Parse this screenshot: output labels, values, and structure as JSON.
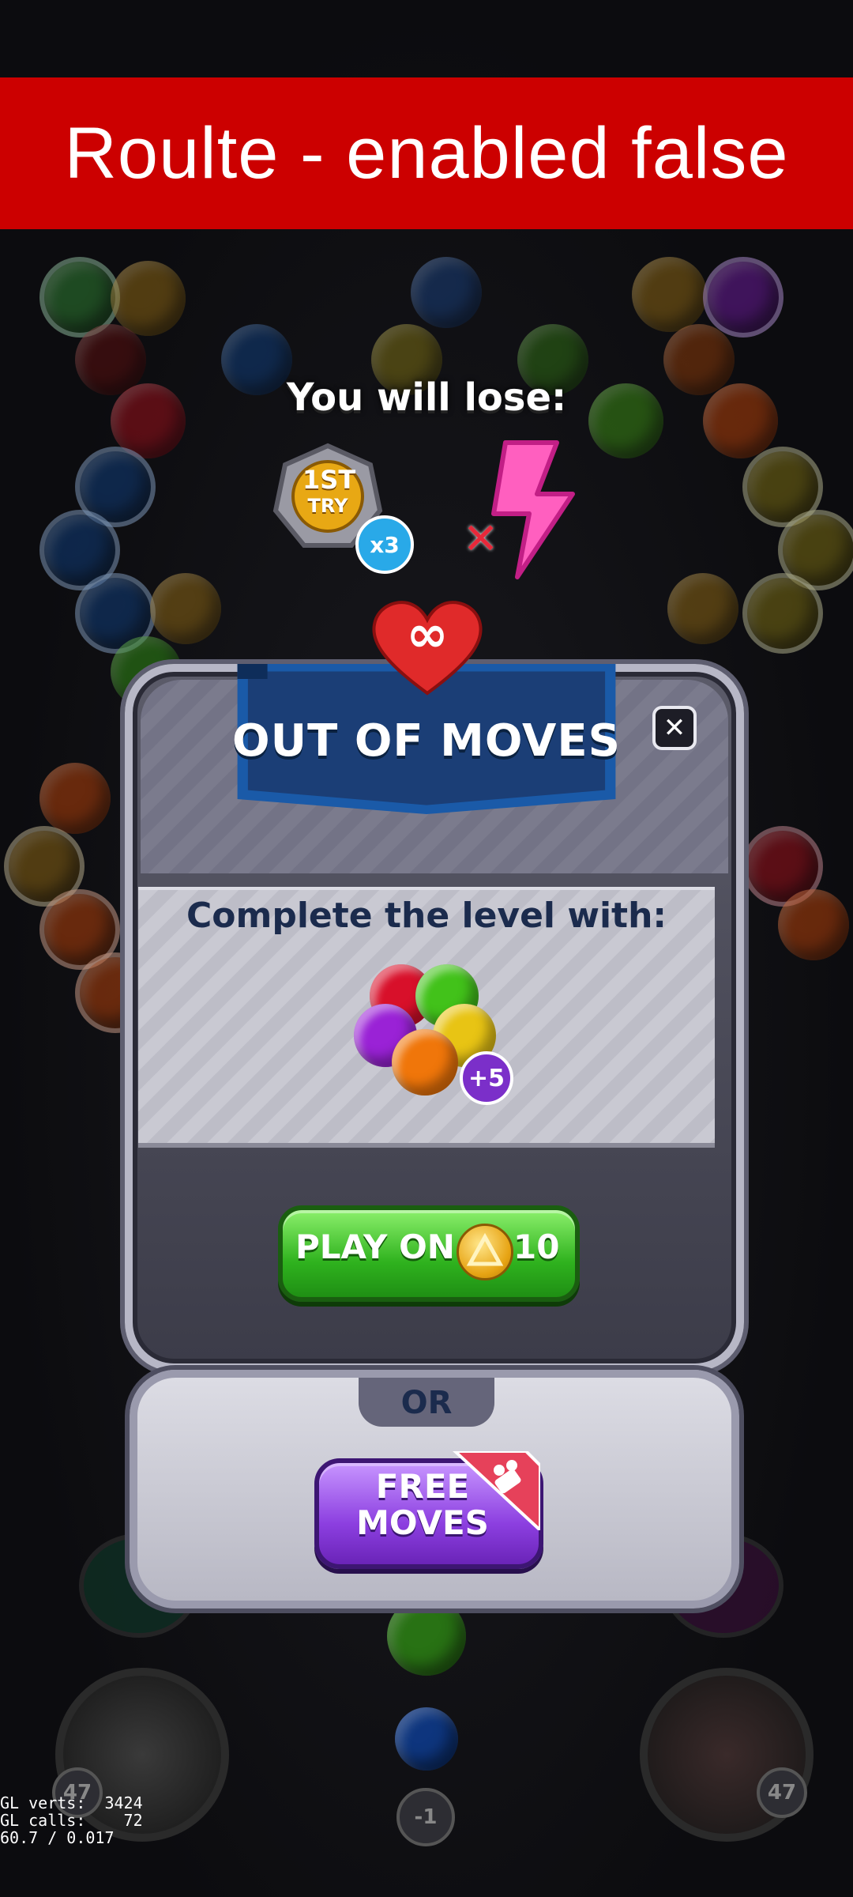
{
  "banner": {
    "text": "Roulte - enabled false"
  },
  "lose": {
    "title": "You will lose:",
    "items": [
      {
        "icon": "first-try-badge-icon",
        "line1": "1ST",
        "line2": "TRY",
        "multiplier": "x3"
      },
      {
        "icon": "lightning-streak-icon",
        "mark": "✕"
      }
    ]
  },
  "dialog": {
    "title": "OUT OF MOVES",
    "close_icon": "✕",
    "subtitle": "Complete the level with:",
    "reward_badge": "+5",
    "play_on": {
      "label": "PLAY ON",
      "coin_icon": "coin-icon",
      "cost": "10"
    }
  },
  "alt": {
    "separator": "OR",
    "free_moves_label_1": "FREE",
    "free_moves_label_2": "MOVES",
    "video_icon": "video-camera-icon"
  },
  "hud": {
    "left_counter": "47",
    "right_counter": "47",
    "center_counter": "-1"
  },
  "debug": {
    "line1": "GL verts:  3424",
    "line2": "GL calls:    72",
    "line3": "60.7 / 0.017"
  },
  "colors": {
    "banner": "#cc0000",
    "play_on": "#2fb21e",
    "free_moves": "#8c3fe0",
    "heart": "#e02a2a"
  }
}
